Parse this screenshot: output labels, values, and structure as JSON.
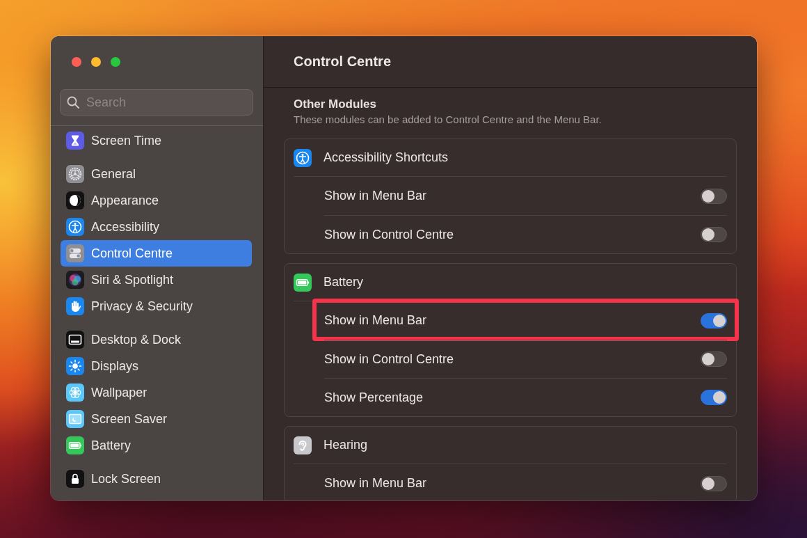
{
  "window": {
    "title": "Control Centre"
  },
  "sidebar": {
    "search": {
      "placeholder": "Search"
    },
    "groups": [
      {
        "items": [
          {
            "label": "Screen Time",
            "selected": false
          }
        ]
      },
      {
        "items": [
          {
            "label": "General",
            "selected": false
          },
          {
            "label": "Appearance",
            "selected": false
          },
          {
            "label": "Accessibility",
            "selected": false
          },
          {
            "label": "Control Centre",
            "selected": true
          },
          {
            "label": "Siri & Spotlight",
            "selected": false
          },
          {
            "label": "Privacy & Security",
            "selected": false
          }
        ]
      },
      {
        "items": [
          {
            "label": "Desktop & Dock",
            "selected": false
          },
          {
            "label": "Displays",
            "selected": false
          },
          {
            "label": "Wallpaper",
            "selected": false
          },
          {
            "label": "Screen Saver",
            "selected": false
          },
          {
            "label": "Battery",
            "selected": false
          }
        ]
      },
      {
        "items": [
          {
            "label": "Lock Screen",
            "selected": false
          }
        ]
      }
    ]
  },
  "section": {
    "title": "Other Modules",
    "description": "These modules can be added to Control Centre and the Menu Bar."
  },
  "modules": [
    {
      "name": "Accessibility Shortcuts",
      "options": [
        {
          "label": "Show in Menu Bar",
          "on": false,
          "highlighted": false
        },
        {
          "label": "Show in Control Centre",
          "on": false,
          "highlighted": false
        }
      ]
    },
    {
      "name": "Battery",
      "options": [
        {
          "label": "Show in Menu Bar",
          "on": true,
          "highlighted": true
        },
        {
          "label": "Show in Control Centre",
          "on": false,
          "highlighted": false
        },
        {
          "label": "Show Percentage",
          "on": true,
          "highlighted": false
        }
      ]
    },
    {
      "name": "Hearing",
      "options": [
        {
          "label": "Show in Menu Bar",
          "on": false,
          "highlighted": false
        }
      ]
    }
  ]
}
